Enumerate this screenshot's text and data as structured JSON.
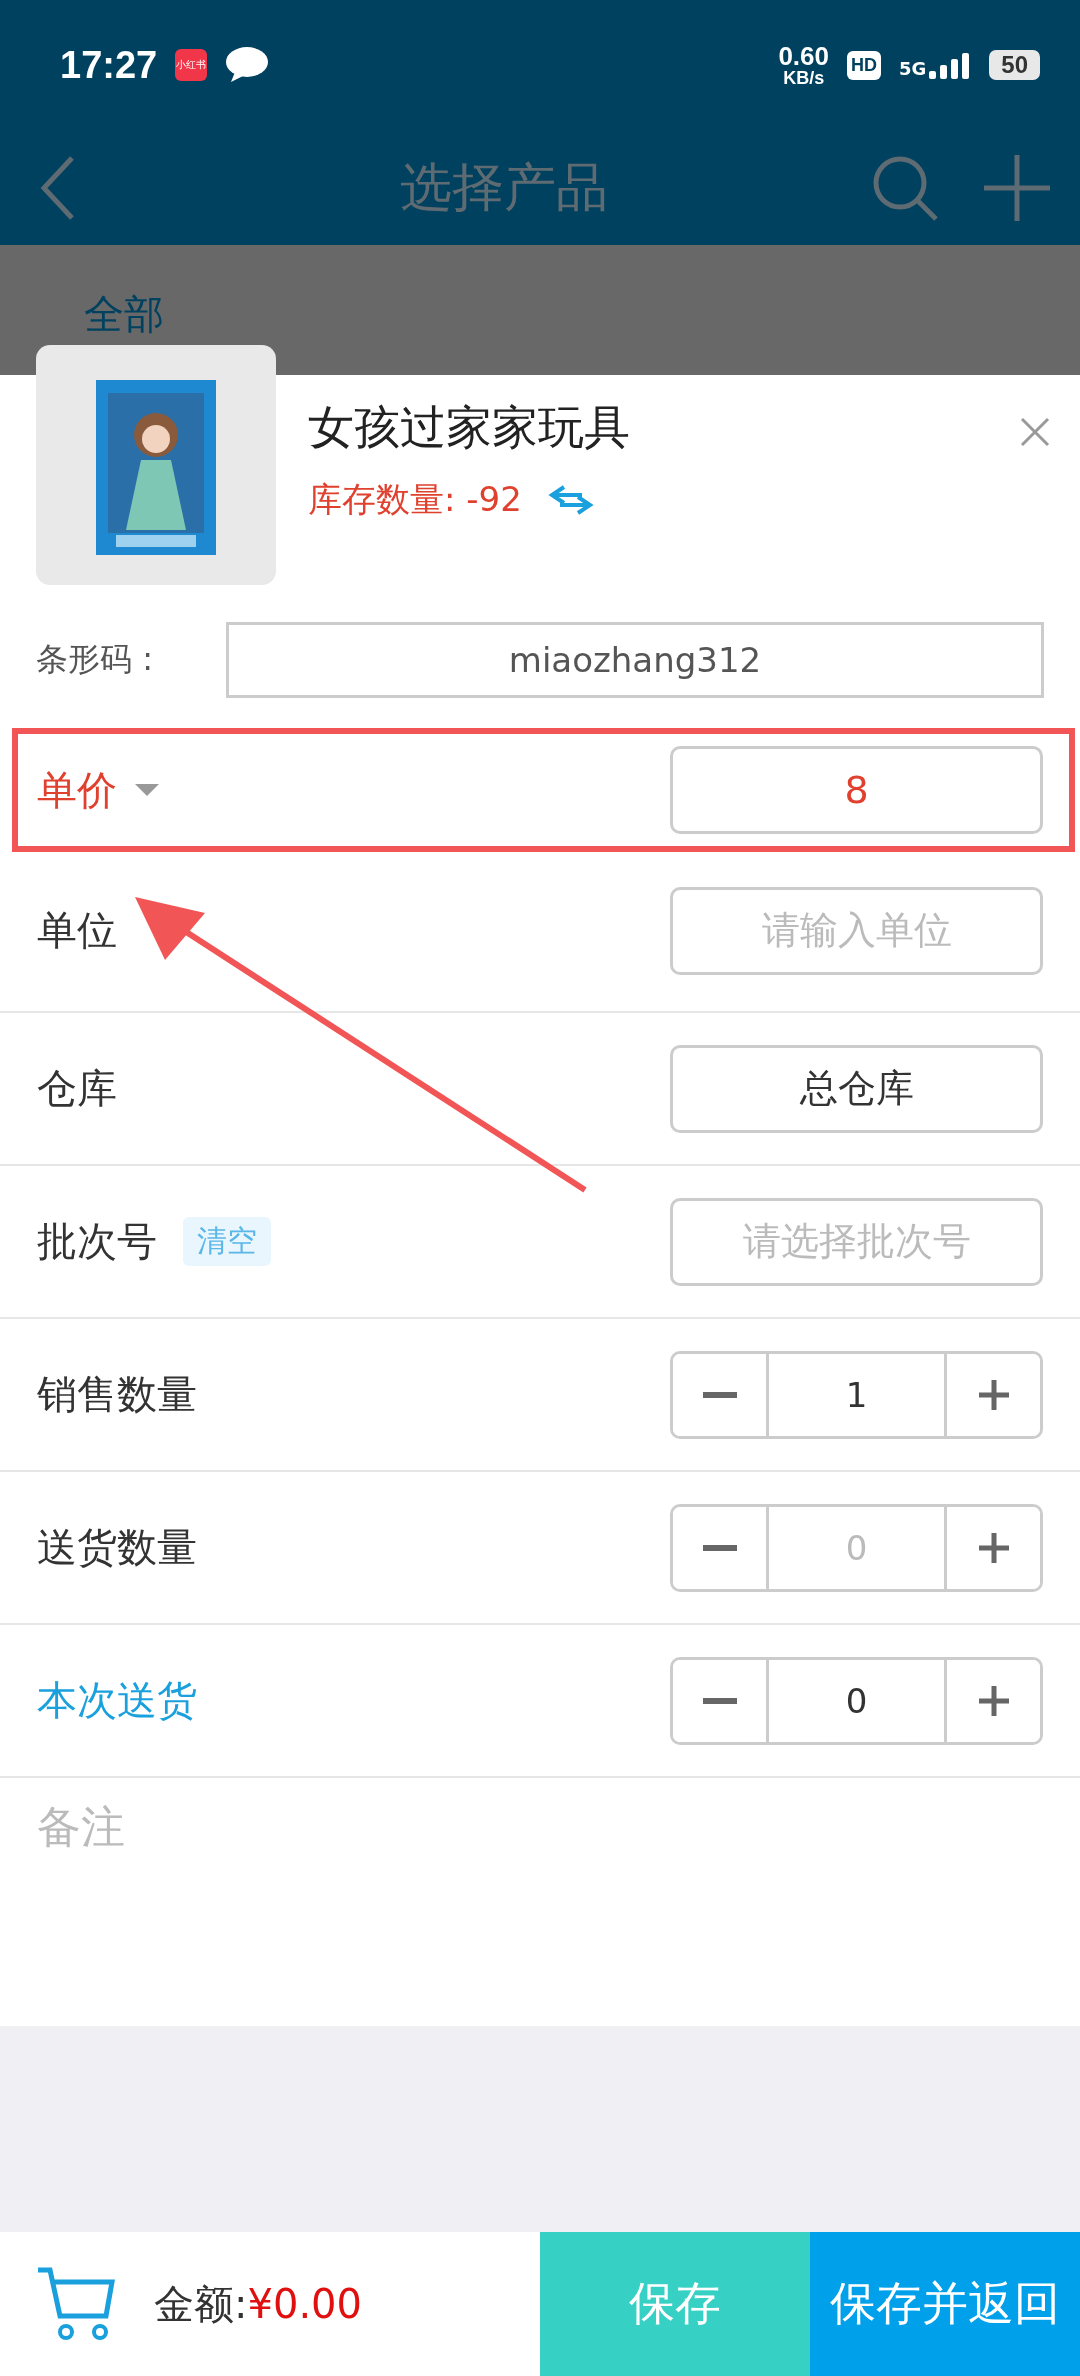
{
  "status_bar": {
    "time": "17:27",
    "app_badge": "小红书",
    "speed_value": "0.60",
    "speed_unit": "KB/s",
    "hd": "HD",
    "network": "5G",
    "battery": "50"
  },
  "header": {
    "title": "选择产品"
  },
  "category_tabs": [
    {
      "label": "全部",
      "selected": true
    }
  ],
  "product": {
    "kind": "picture",
    "name": "女孩过家家玩具",
    "stock_label": "库存数量:",
    "stock_value": "-92"
  },
  "barcode": {
    "label": "条形码 :",
    "value": "miaozhang312"
  },
  "fields": [
    {
      "kind": "dropdown",
      "label": "单价",
      "value": "8",
      "highlighted": true
    },
    {
      "kind": "input",
      "label": "单位",
      "placeholder": "请输入单位"
    },
    {
      "kind": "select",
      "label": "仓库",
      "value": "总仓库"
    },
    {
      "kind": "select",
      "label": "批次号",
      "badge": "清空",
      "placeholder": "请选择批次号"
    },
    {
      "kind": "stepper",
      "label": "销售数量",
      "value": "1",
      "disabled": false
    },
    {
      "kind": "stepper",
      "label": "送货数量",
      "value": "0",
      "disabled": true
    },
    {
      "kind": "stepper",
      "label": "本次送货",
      "value": "0",
      "disabled": false,
      "accent": true
    }
  ],
  "notes": {
    "placeholder": "备注"
  },
  "footer": {
    "amount_label": "金额:",
    "amount_value": "¥0.00",
    "buttons": [
      {
        "label": "保存",
        "color": "#36d1c4"
      },
      {
        "label": "保存并返回",
        "color": "#00a0ea"
      }
    ]
  }
}
